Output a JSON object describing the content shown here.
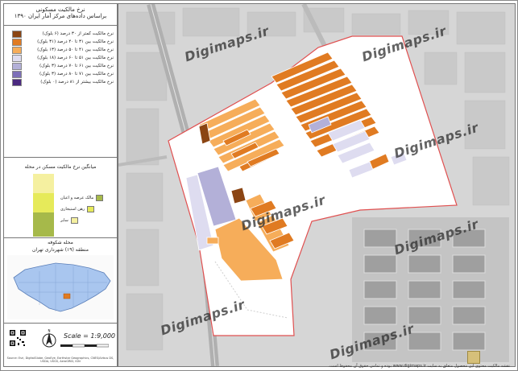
{
  "panel": {
    "title_line1": "نرخ مالکیت مسکونی",
    "title_line2": "براساس داده‌های مرکز آمار ایران ۱۳۹۰"
  },
  "legend": {
    "items": [
      {
        "label": "نرخ مالکیت کمتر از ۳۰ درصد (۶ بلوک)",
        "color": "#8b4513"
      },
      {
        "label": "نرخ مالکیت بین ۳۱ تا ۴۰ درصد (۳۱ بلوک)",
        "color": "#e07b22"
      },
      {
        "label": "نرخ مالکیت بین ۴۱ تا ۵۰ درصد (۱۳ بلوک)",
        "color": "#f6ad5a"
      },
      {
        "label": "نرخ مالکیت بین ۵۱ تا ۶۰ درصد (۱۸ بلوک)",
        "color": "#dedcf0"
      },
      {
        "label": "نرخ مالکیت بین ۶۱ تا ۷۰ درصد (۳ بلوک)",
        "color": "#b3b0d8"
      },
      {
        "label": "نرخ مالکیت بین ۷۱ تا ۸۰ درصد (۳ بلوک)",
        "color": "#7d6fb8"
      },
      {
        "label": "نرخ مالکیت بیشتر از ۸۱ درصد (۰ بلوک)",
        "color": "#4b2a80"
      }
    ]
  },
  "chart": {
    "title": "میانگین نرخ مالکیت مسکن در محله",
    "segments": [
      {
        "label": "مالک عرصه و اعیان",
        "color": "#a6b94a",
        "value": 38
      },
      {
        "label": "رهن استیجاری",
        "color": "#e6ea5a",
        "value": 30
      },
      {
        "label": "سایر",
        "color": "#f5f0a0",
        "value": 32
      }
    ]
  },
  "location": {
    "line1": "محله شکوفه",
    "line2": "منطقه (۱۹) شهرداری تهران"
  },
  "scale": {
    "text": "Scale = 1:9,000"
  },
  "watermarks": [
    "Digimaps.ir",
    "Digimaps.ir",
    "Digimaps.ir",
    "Digimaps.ir",
    "Digimaps.ir",
    "Digimaps.ir",
    "Digimaps.ir"
  ],
  "footer": "نقشه مالکیت محتوی این محصول متعلق به سایت www.digimaps.ir بوده و تمامی حقوق آن محفوظ است.",
  "credit": "Source: Esri, DigitalGlobe, GeoEye, Earthstar Geographics, CNES/Airbus DS, USDA, USGS, AeroGRID, IGN",
  "colors": {
    "boundary": "#e05050",
    "map_bg": "#d8d8d8"
  }
}
